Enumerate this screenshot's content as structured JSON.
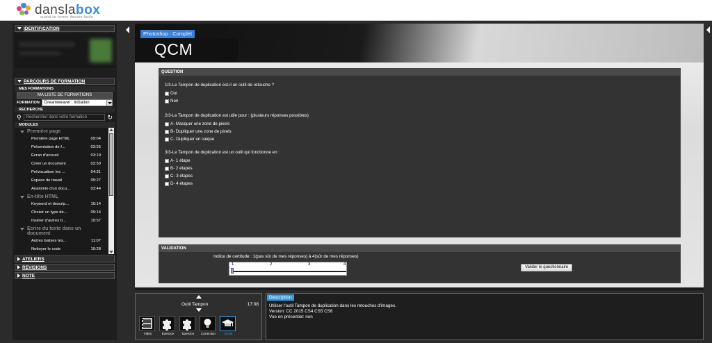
{
  "brand": {
    "name_prefix": "dansla",
    "name_suffix": "box",
    "tagline": "quand se former devient facile"
  },
  "sidebar": {
    "identification_label": "IDENTIFICATION",
    "parcours_label": "PARCOURS DE FORMATION",
    "mes_formations_label": "MES FORMATIONS",
    "ma_liste_label": "MA LISTE DE FORMATIONS",
    "formation_label": "FORMATION",
    "formation_value": "Dreamweaver : Initiation",
    "recherche_label": "RECHERCHE",
    "search_placeholder": "Rechercher dans votre formation",
    "modules_label": "MODULES",
    "groups": [
      {
        "title": "Première page",
        "items": [
          {
            "label": "Première page HTML",
            "time": "09:04"
          },
          {
            "label": "Présentation de f...",
            "time": "03:55"
          },
          {
            "label": "Écran d'accueil",
            "time": "03:19"
          },
          {
            "label": "Créer un document",
            "time": "02:50"
          },
          {
            "label": "Prévisualiser les ...",
            "time": "04:31"
          },
          {
            "label": "Espace de travail",
            "time": "05:27"
          },
          {
            "label": "Anatomie d'un docu...",
            "time": "03:44"
          }
        ]
      },
      {
        "title": "En-tête HTML",
        "items": [
          {
            "label": "Keyword et descrip...",
            "time": "10:14"
          },
          {
            "label": "Choisir un type de...",
            "time": "09:14"
          },
          {
            "label": "Insérer d'autres b...",
            "time": "10:57"
          }
        ]
      },
      {
        "title_line1": "Ecrire du texte dans un",
        "title_line2": "document",
        "items": [
          {
            "label": "Autres balises tex...",
            "time": "11:07"
          },
          {
            "label": "Nettoyer le code",
            "time": "10:28"
          }
        ]
      }
    ],
    "ateliers_label": "ATELIERS",
    "revisions_label": "REVISIONS",
    "note_label": "NOTE"
  },
  "main": {
    "tab_label": "Photoshop : Complet",
    "title": "QCM",
    "question_header": "QUESTION",
    "questions": [
      {
        "text": "1/3-Le Tampon de duplication est-il un outil de retouche ?",
        "options": [
          "Oui",
          "Non"
        ]
      },
      {
        "text": "2/3-Le Tampon de duplication est utile pour : (plusieurs réponses possibles)",
        "options": [
          "A- Masquer une zone de pixels",
          "B- Dupliquer une zone de pixels",
          "C- Dupliquer un calque"
        ]
      },
      {
        "text": "3/3-Le Tampon de duplication est un outil qui fonctionne en :",
        "options": [
          "A- 1 étape",
          "B- 2 étapes",
          "C- 3 étapes",
          "D- 4 étapes"
        ]
      }
    ],
    "validation_header": "VALIDATION",
    "certitude_label": "Indice de certitude : 1(pas sûr de mes réponses) à 4(sûr de mes réponses)",
    "certitude_ticks": [
      "1",
      "2",
      "3",
      "4"
    ],
    "certitude_value": 1,
    "validate_button": "Valider le questionnaire"
  },
  "player": {
    "title": "Outil Tampon",
    "duration": "17:08",
    "thumbs": [
      {
        "label": "Vidéo",
        "icon": "film-icon"
      },
      {
        "label": "Exercice",
        "icon": "puzzle-icon"
      },
      {
        "label": "Exercice",
        "icon": "puzzle-icon"
      },
      {
        "label": "Correction",
        "icon": "bulb-icon"
      },
      {
        "label": "02:56",
        "icon": "graduation-cap-icon"
      }
    ]
  },
  "description": {
    "tab_label": "Description",
    "line1": "Utiliser l'outil Tampon de duplication dans les retouches d'images.",
    "line2": "Version: CC 2015 CS4 CS5 CS6",
    "line3": "Vue en présentiel: non"
  },
  "colors": {
    "accent": "#3a7fd0",
    "active_thumb": "#39a2e0"
  }
}
